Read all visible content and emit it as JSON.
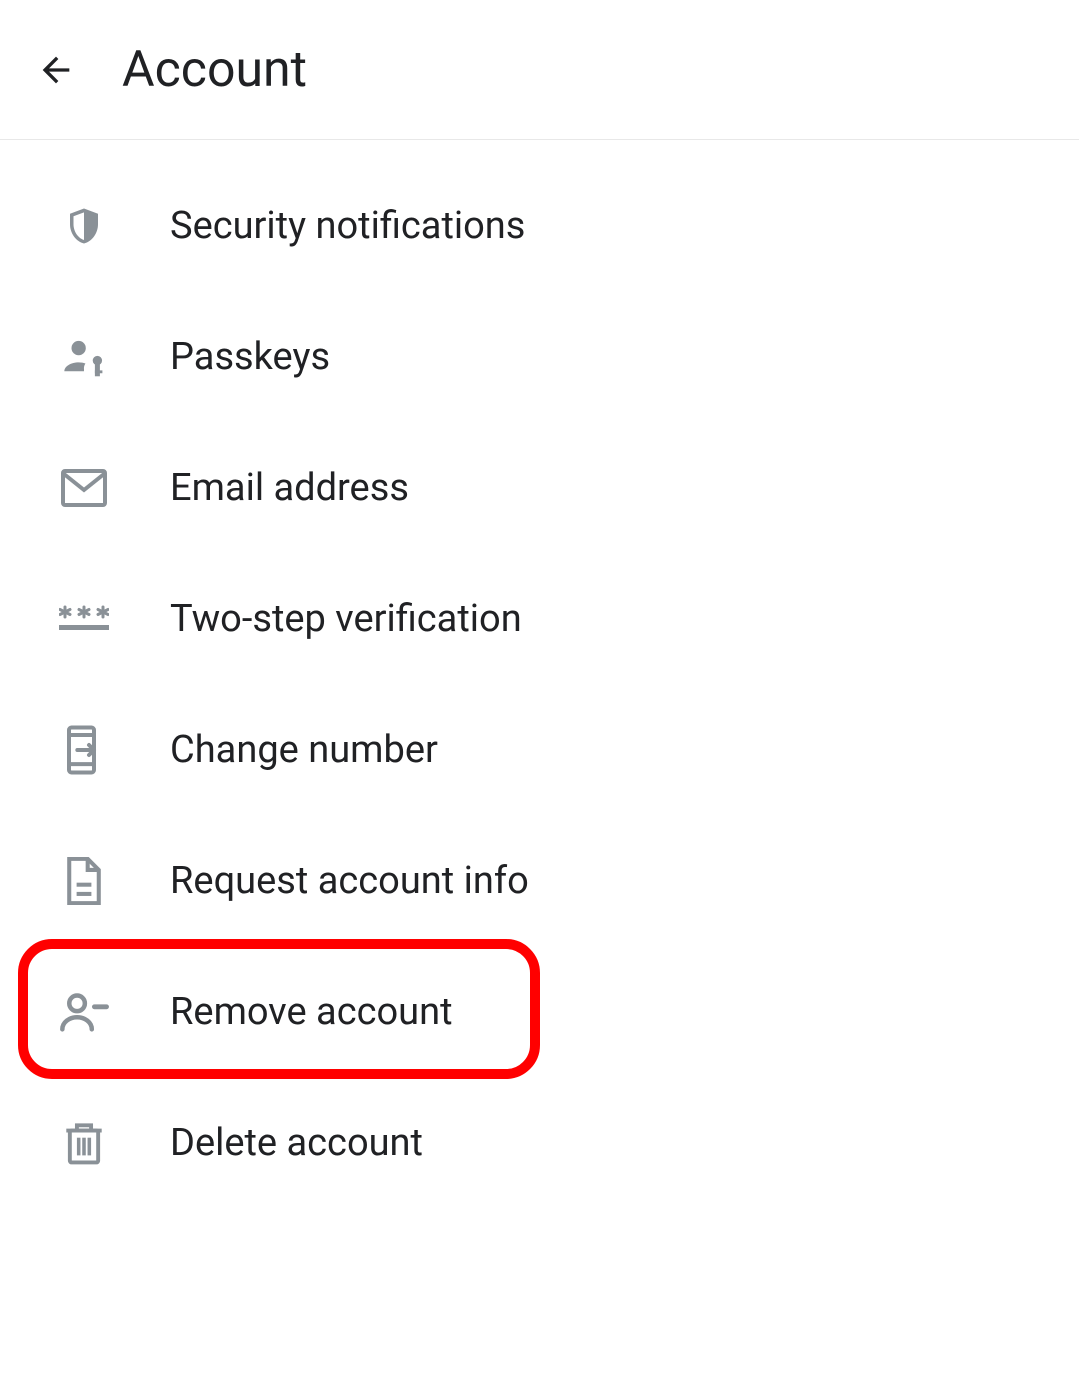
{
  "header": {
    "title": "Account"
  },
  "items": [
    {
      "label": "Security notifications",
      "icon": "shield-icon",
      "highlighted": false
    },
    {
      "label": "Passkeys",
      "icon": "person-key-icon",
      "highlighted": false
    },
    {
      "label": "Email address",
      "icon": "mail-icon",
      "highlighted": false
    },
    {
      "label": "Two-step verification",
      "icon": "password-icon",
      "highlighted": false
    },
    {
      "label": "Change number",
      "icon": "phone-arrow-icon",
      "highlighted": false
    },
    {
      "label": "Request account info",
      "icon": "document-icon",
      "highlighted": false
    },
    {
      "label": "Remove account",
      "icon": "person-minus-icon",
      "highlighted": true
    },
    {
      "label": "Delete account",
      "icon": "trash-icon",
      "highlighted": false
    }
  ]
}
